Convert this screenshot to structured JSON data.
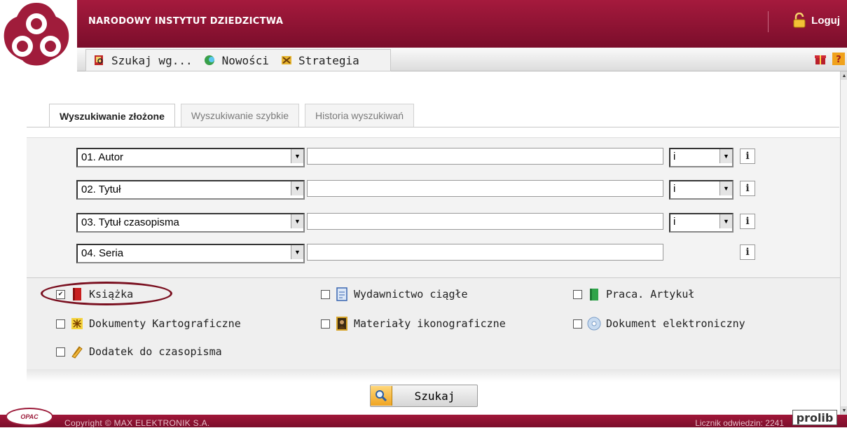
{
  "header": {
    "title": "NARODOWY INSTYTUT DZIEDZICTWA",
    "login_label": "Loguj"
  },
  "menu": {
    "items": [
      {
        "label": "Szukaj wg...",
        "icon": "search-book-icon"
      },
      {
        "label": "Nowości",
        "icon": "news-icon"
      },
      {
        "label": "Strategia",
        "icon": "strategy-icon"
      }
    ]
  },
  "tabs": [
    {
      "label": "Wyszukiwanie złożone",
      "active": true
    },
    {
      "label": "Wyszukiwanie szybkie",
      "active": false
    },
    {
      "label": "Historia wyszukiwań",
      "active": false
    }
  ],
  "search_rows": [
    {
      "field": "01. Autor",
      "value": "",
      "operator": "i",
      "info": "i"
    },
    {
      "field": "02. Tytuł",
      "value": "",
      "operator": "i",
      "info": "i"
    },
    {
      "field": "03. Tytuł czasopisma",
      "value": "",
      "operator": "i",
      "info": "i"
    },
    {
      "field": "04. Seria",
      "value": "",
      "operator": null,
      "info": "i"
    }
  ],
  "document_types": [
    {
      "label": "Książka",
      "checked": true,
      "icon": "book-icon"
    },
    {
      "label": "Wydawnictwo ciągłe",
      "checked": false,
      "icon": "periodical-icon"
    },
    {
      "label": "Praca. Artykuł",
      "checked": false,
      "icon": "article-icon"
    },
    {
      "label": "Dokumenty Kartograficzne",
      "checked": false,
      "icon": "map-icon"
    },
    {
      "label": "Materiały ikonograficzne",
      "checked": false,
      "icon": "painting-icon"
    },
    {
      "label": "Dokument elektroniczny",
      "checked": false,
      "icon": "cd-icon"
    },
    {
      "label": "Dodatek do czasopisma",
      "checked": false,
      "icon": "attachment-icon"
    }
  ],
  "search_button": {
    "label": "Szukaj"
  },
  "footer": {
    "copyright": "Copyright © MAX ELEKTRONIK S.A.",
    "counter": "Licznik odwiedzin: 2241",
    "opac": "OPAC",
    "prolib": "prolib"
  },
  "colors": {
    "brand": "#8e1333",
    "highlight": "#7a1020"
  }
}
